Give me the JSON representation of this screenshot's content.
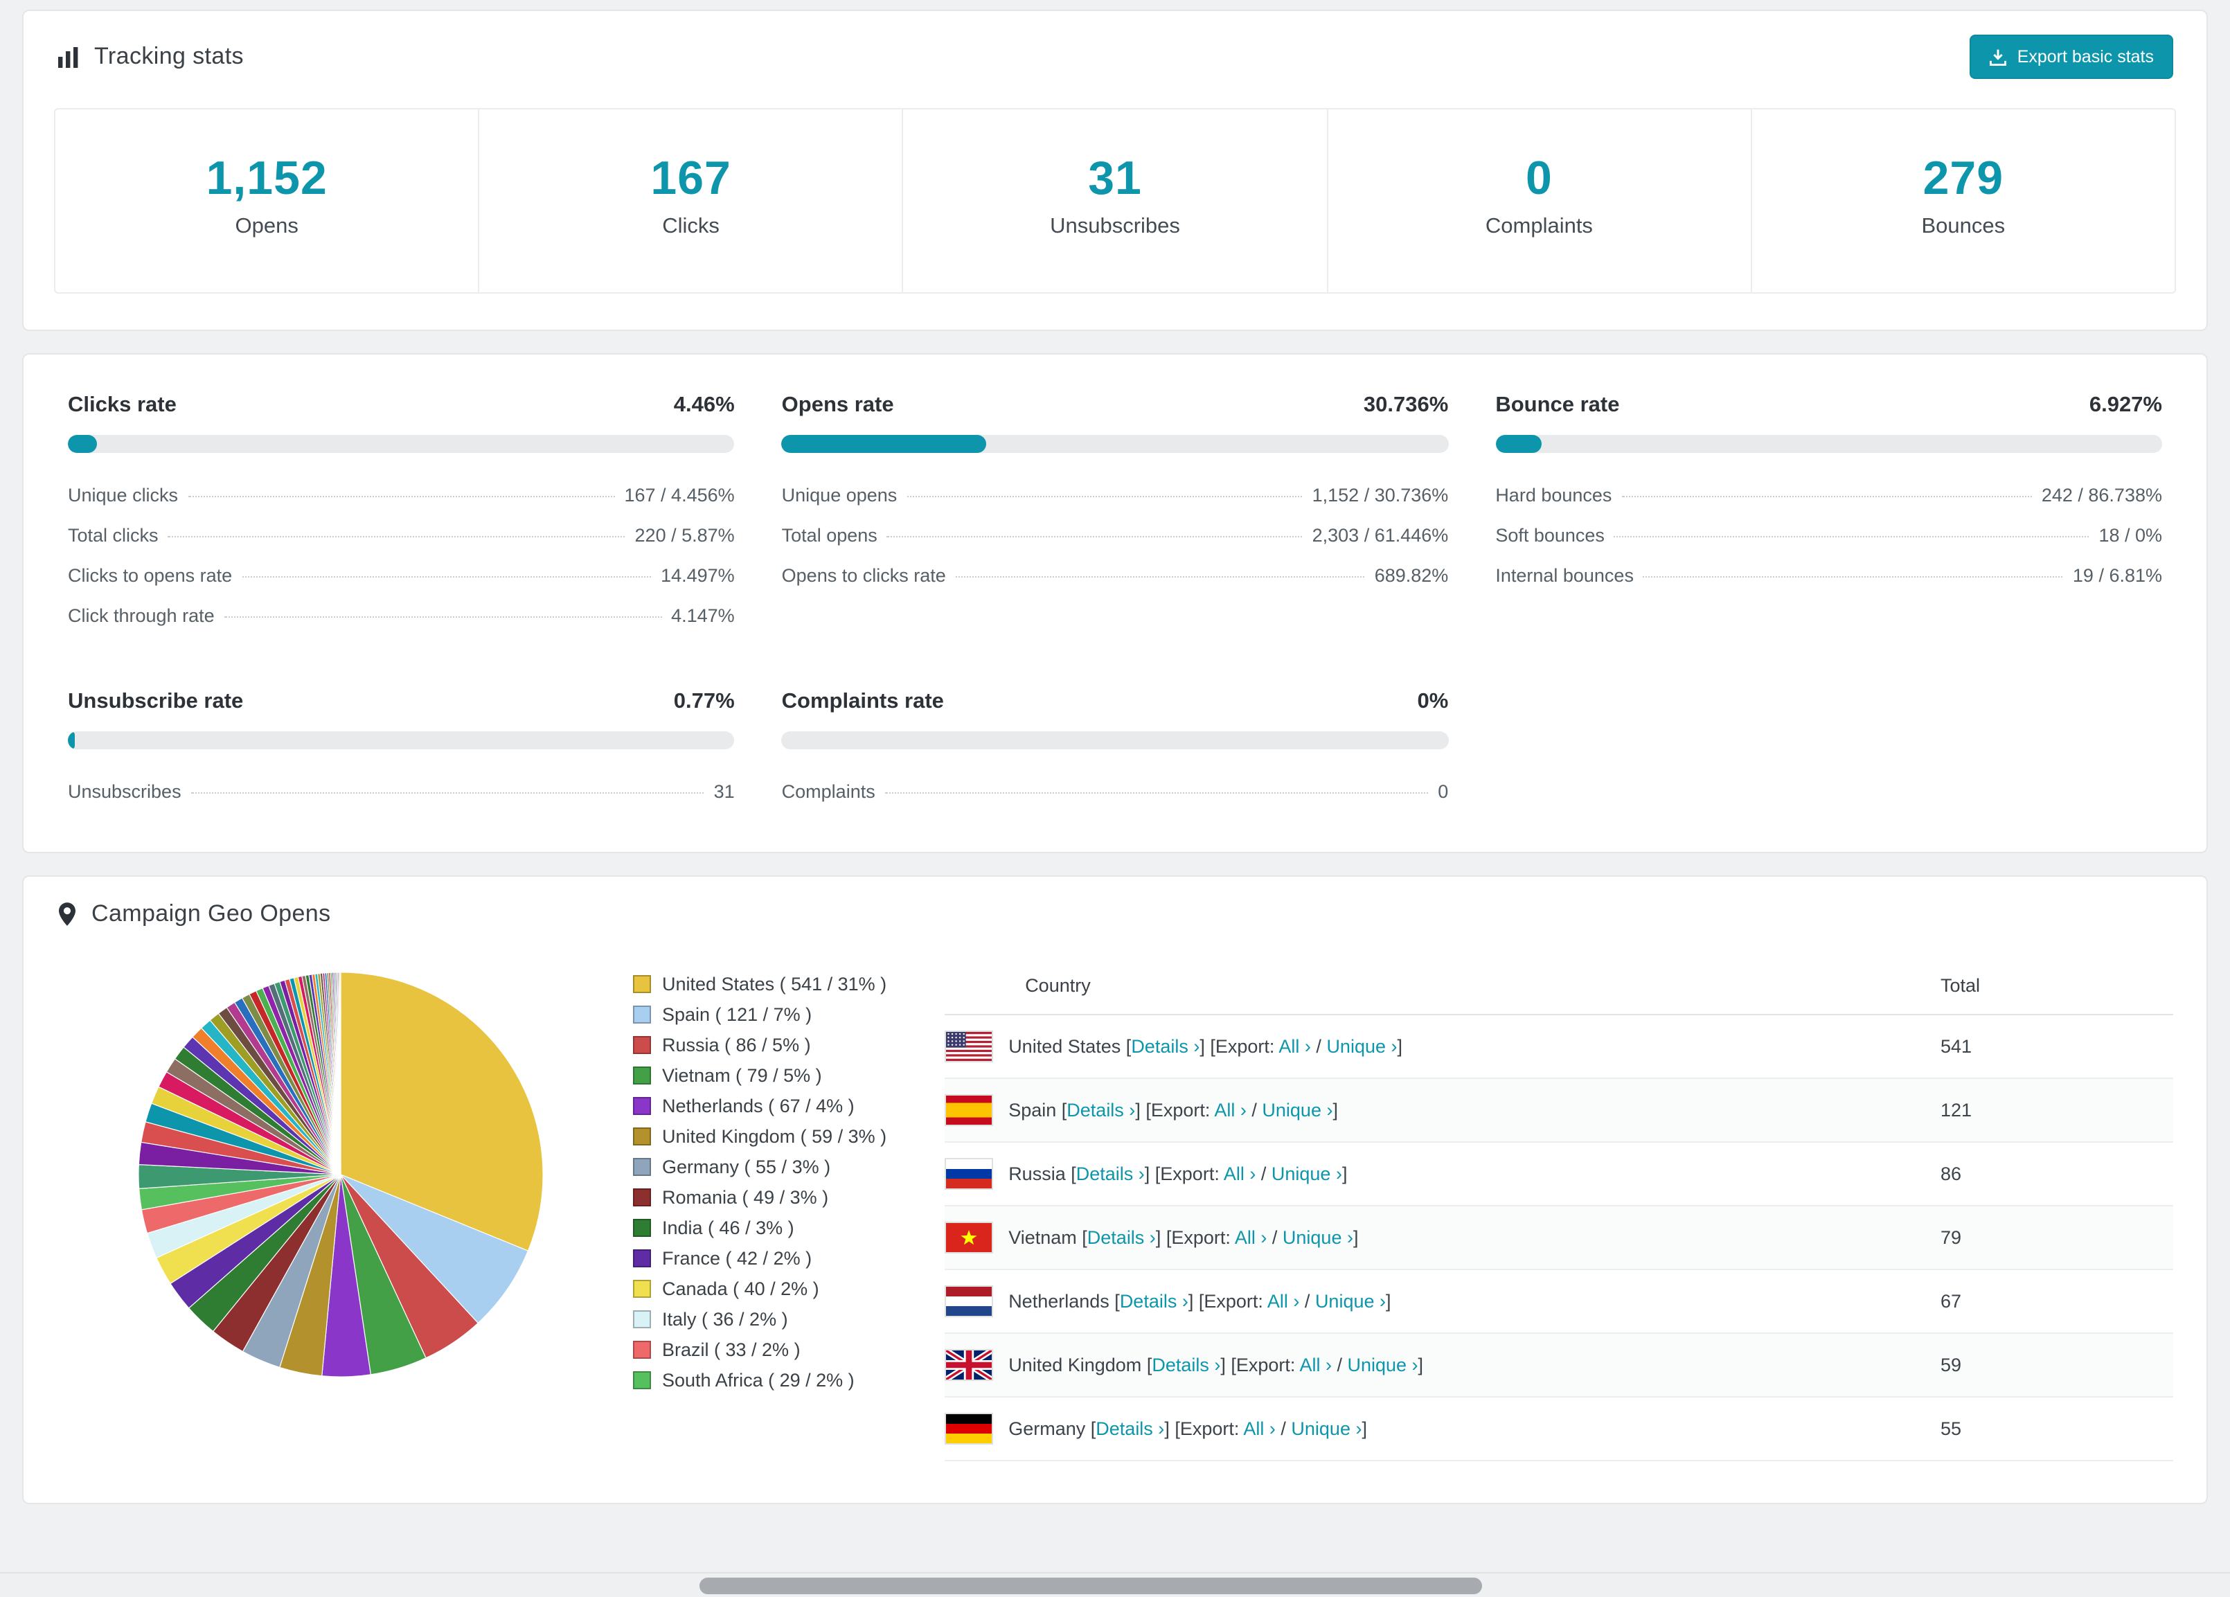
{
  "colors": {
    "accent": "#0d96ab",
    "page_bg": "#f0f1f2",
    "card_border": "#e4e6e8"
  },
  "tracking": {
    "title": "Tracking stats",
    "export_button": "Export basic stats",
    "stats": [
      {
        "value": "1,152",
        "label": "Opens"
      },
      {
        "value": "167",
        "label": "Clicks"
      },
      {
        "value": "31",
        "label": "Unsubscribes"
      },
      {
        "value": "0",
        "label": "Complaints"
      },
      {
        "value": "279",
        "label": "Bounces"
      }
    ]
  },
  "rates": [
    {
      "title": "Clicks rate",
      "pct_label": "4.46%",
      "pct": 4.46,
      "rows": [
        {
          "label": "Unique clicks",
          "value": "167 / 4.456%"
        },
        {
          "label": "Total clicks",
          "value": "220 / 5.87%"
        },
        {
          "label": "Clicks to opens rate",
          "value": "14.497%"
        },
        {
          "label": "Click through rate",
          "value": "4.147%"
        }
      ]
    },
    {
      "title": "Opens rate",
      "pct_label": "30.736%",
      "pct": 30.736,
      "rows": [
        {
          "label": "Unique opens",
          "value": "1,152 / 30.736%"
        },
        {
          "label": "Total opens",
          "value": "2,303 / 61.446%"
        },
        {
          "label": "Opens to clicks rate",
          "value": "689.82%"
        }
      ]
    },
    {
      "title": "Bounce rate",
      "pct_label": "6.927%",
      "pct": 6.927,
      "rows": [
        {
          "label": "Hard bounces",
          "value": "242 / 86.738%"
        },
        {
          "label": "Soft bounces",
          "value": "18 / 0%"
        },
        {
          "label": "Internal bounces",
          "value": "19 / 6.81%"
        }
      ]
    },
    {
      "title": "Unsubscribe rate",
      "pct_label": "0.77%",
      "pct": 0.77,
      "rows": [
        {
          "label": "Unsubscribes",
          "value": "31"
        }
      ]
    },
    {
      "title": "Complaints rate",
      "pct_label": "0%",
      "pct": 0,
      "rows": [
        {
          "label": "Complaints",
          "value": "0"
        }
      ]
    }
  ],
  "geo": {
    "title": "Campaign Geo Opens",
    "table": {
      "headers": [
        "Country",
        "Total"
      ],
      "labels": {
        "details": "Details",
        "export": "Export:",
        "all": "All",
        "unique": "Unique",
        "chevron": "›"
      },
      "rows": [
        {
          "country": "United States",
          "flag": "us",
          "total": "541"
        },
        {
          "country": "Spain",
          "flag": "es",
          "total": "121"
        },
        {
          "country": "Russia",
          "flag": "ru",
          "total": "86"
        },
        {
          "country": "Vietnam",
          "flag": "vn",
          "total": "79"
        },
        {
          "country": "Netherlands",
          "flag": "nl",
          "total": "67"
        },
        {
          "country": "United Kingdom",
          "flag": "gb",
          "total": "59"
        },
        {
          "country": "Germany",
          "flag": "de",
          "total": "55"
        }
      ]
    }
  },
  "chart_data": {
    "type": "pie",
    "title": "Campaign Geo Opens",
    "legend_position": "right",
    "slices": [
      {
        "label": "United States",
        "value": 541,
        "pct": 31,
        "color": "#e7c33f"
      },
      {
        "label": "Spain",
        "value": 121,
        "pct": 7,
        "color": "#a9cff0"
      },
      {
        "label": "Russia",
        "value": 86,
        "pct": 5,
        "color": "#cc4b4b"
      },
      {
        "label": "Vietnam",
        "value": 79,
        "pct": 5,
        "color": "#43a047"
      },
      {
        "label": "Netherlands",
        "value": 67,
        "pct": 4,
        "color": "#8a36c9"
      },
      {
        "label": "United Kingdom",
        "value": 59,
        "pct": 3,
        "color": "#b3912c"
      },
      {
        "label": "Germany",
        "value": 55,
        "pct": 3,
        "color": "#8ea5bc"
      },
      {
        "label": "Romania",
        "value": 49,
        "pct": 3,
        "color": "#8e2f2f"
      },
      {
        "label": "India",
        "value": 46,
        "pct": 3,
        "color": "#2f7d33"
      },
      {
        "label": "France",
        "value": 42,
        "pct": 2,
        "color": "#5e2ca5"
      },
      {
        "label": "Canada",
        "value": 40,
        "pct": 2,
        "color": "#f0df4e"
      },
      {
        "label": "Italy",
        "value": 36,
        "pct": 2,
        "color": "#d9f2f6"
      },
      {
        "label": "Brazil",
        "value": 33,
        "pct": 2,
        "color": "#ee6a6a"
      },
      {
        "label": "South Africa",
        "value": 29,
        "pct": 2,
        "color": "#57c05e"
      }
    ],
    "other_slices": {
      "note": "many additional small countries shown as thin unlabeled slices",
      "approx_total": 462,
      "count": 45,
      "colors": [
        "#3d9970",
        "#7b1fa2",
        "#d94f4f",
        "#0d96ab",
        "#e8d23c",
        "#d81b60",
        "#8d6e63",
        "#2e7d32",
        "#5e35b1",
        "#ef7f2a",
        "#26b5c4",
        "#9e9d24",
        "#6d4c41",
        "#b23b8f",
        "#2a6fbd",
        "#7f8c45",
        "#c62828",
        "#4caf50",
        "#8e24aa",
        "#546e7a"
      ]
    }
  }
}
